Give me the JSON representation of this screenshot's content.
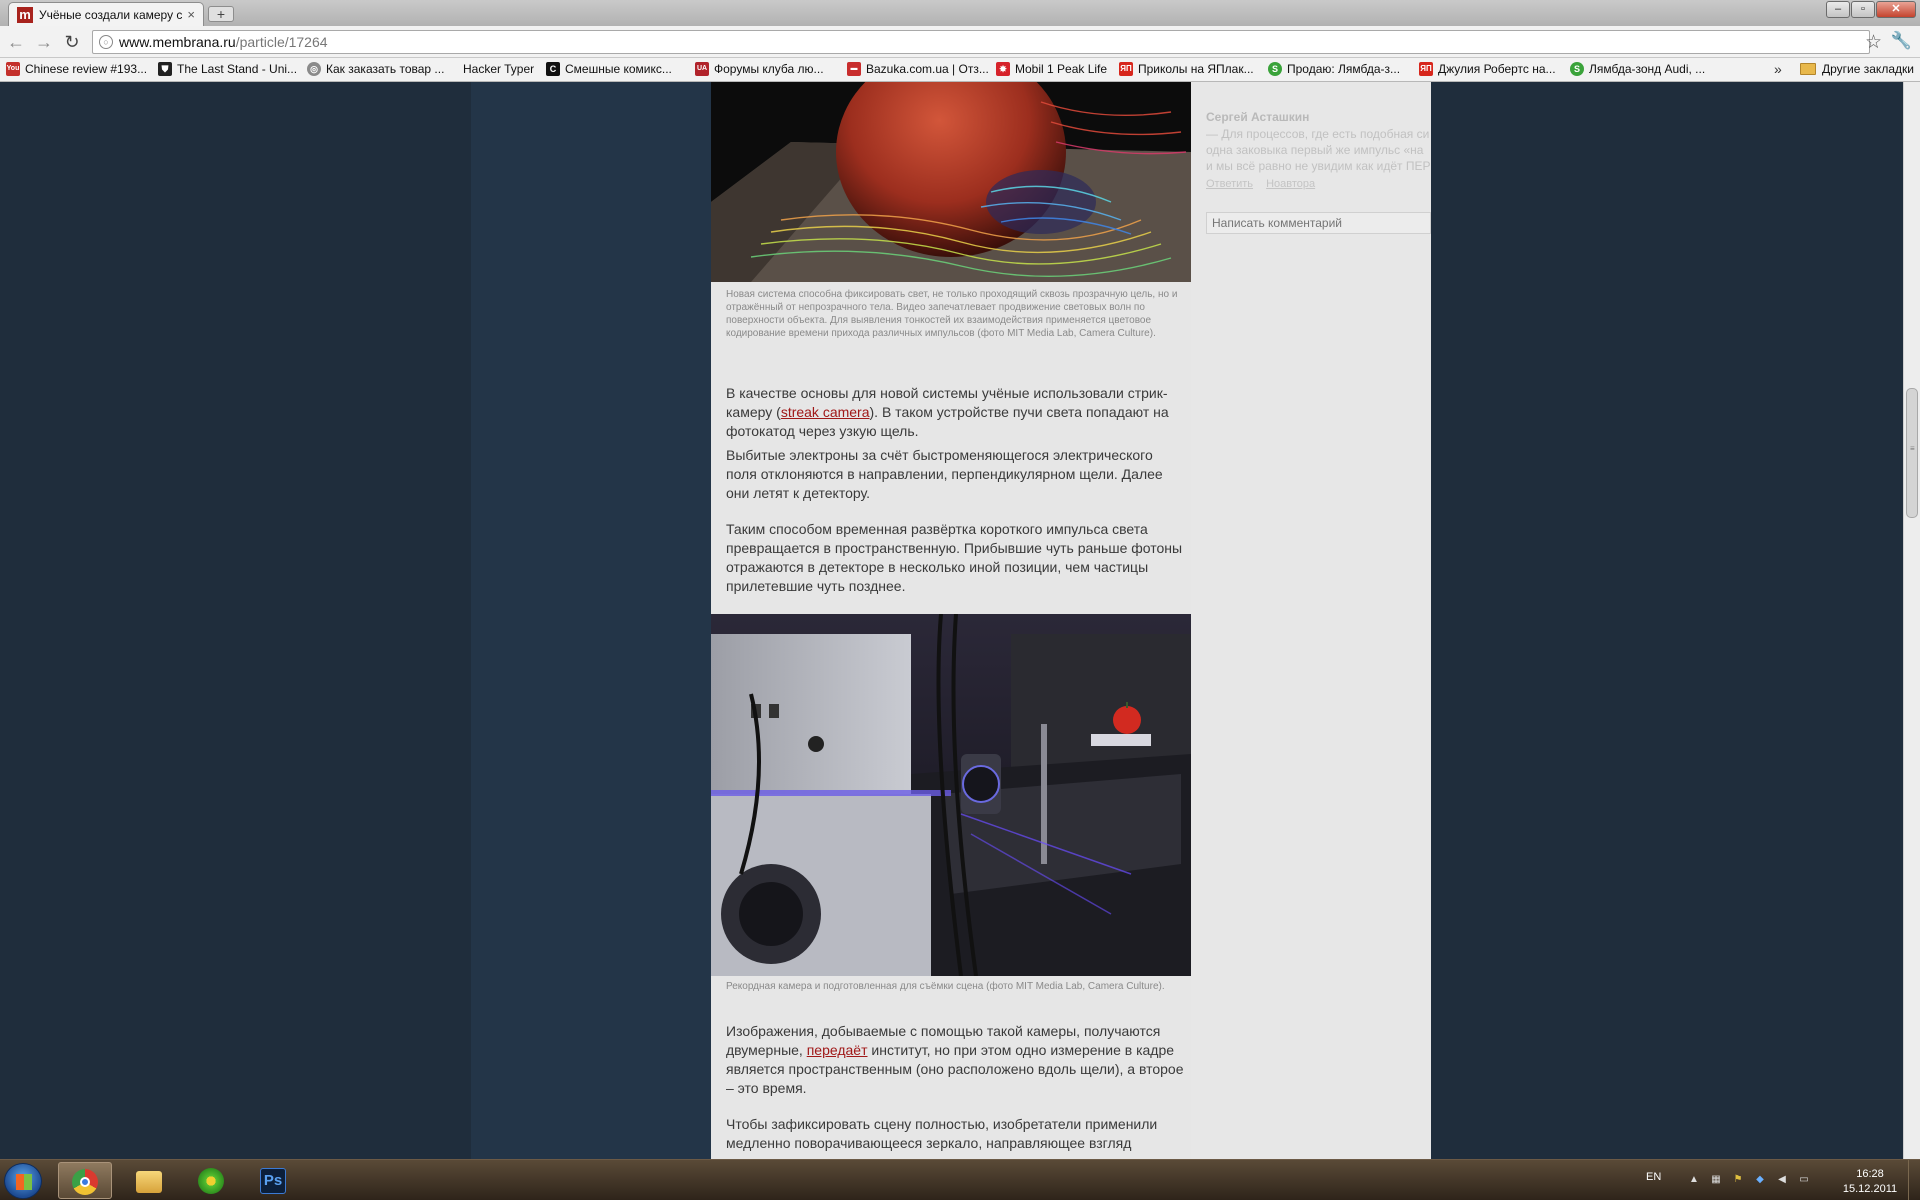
{
  "tab": {
    "title": "Учёные создали камеру с",
    "favicon": "m",
    "close": "×",
    "new_tab": "+"
  },
  "window": {
    "minimize": "–",
    "maximize": "▫",
    "close": "✕"
  },
  "toolbar": {
    "back": "←",
    "forward": "→",
    "reload": "↻",
    "url_host": "www.membrana.ru",
    "url_path": "/particle/17264",
    "star": "☆",
    "wrench": "🔧"
  },
  "bookmarks": {
    "items": [
      {
        "label": "Chinese review #193...",
        "icon": "You",
        "color": "#c4302b"
      },
      {
        "label": "The Last Stand - Uni...",
        "icon": "⛊",
        "color": "#222222"
      },
      {
        "label": "Как заказать товар ...",
        "icon": "◎",
        "color": "#7a7a7a"
      },
      {
        "label": "Hacker Typer",
        "icon": "",
        "color": "transparent"
      },
      {
        "label": "Смешные комикс...",
        "icon": "C",
        "color": "#111111"
      },
      {
        "label": "Форумы клуба лю...",
        "icon": "UA",
        "color": "#b1232b"
      },
      {
        "label": "Bazuka.com.ua | Отз...",
        "icon": "▬",
        "color": "#c82d2d"
      },
      {
        "label": "Mobil 1 Peak Life",
        "icon": "✸",
        "color": "#d6222a"
      },
      {
        "label": "Приколы на ЯПлак...",
        "icon": "ЯП",
        "color": "#d7261c"
      },
      {
        "label": "Продаю: Лямбда-з...",
        "icon": "S",
        "color": "#3aa33a"
      },
      {
        "label": "Джулия Робертс на...",
        "icon": "ЯП",
        "color": "#d7261c"
      },
      {
        "label": "Лямбда-зонд Audi, ...",
        "icon": "S",
        "color": "#3aa33a"
      }
    ],
    "chevron": "»",
    "other": "Другие закладки"
  },
  "sidebar": {
    "comment_author": "Сергей Асташкин",
    "comment_text": "— Для процессов, где есть подобная си\nодна заковыка первый же импульс «на\nи мы всё равно не увидим как идёт ПЕР",
    "reply": "Ответить",
    "link": "Ноавтора",
    "comment_placeholder": "Написать комментарий"
  },
  "article": {
    "caption1": "Новая система способна фиксировать свет, не только проходящий сквозь прозрачную цель, но и отражённый от непрозрачного тела. Видео запечатлевает продвижение световых волн по поверхности объекта. Для выявления тонкостей их взаимодействия применяется цветовое кодирование времени прихода различных импульсов (фото MIT Media Lab, Camera Culture).",
    "p1_before": "В качестве основы для новой системы учёные использовали стрик-камеру (",
    "p1_link": "streak camera",
    "p1_after": "). В таком устройстве пучи света попадают на фотокатод через узкую щель.",
    "p2": "Выбитые электроны за счёт быстроменяющегося электрического поля отклоняются в направлении, перпендикулярном щели. Далее они летят к детектору.",
    "p3": "Таким способом временная развёртка короткого импульса света превращается в пространственную. Прибывшие чуть раньше фотоны отражаются в детекторе в несколько иной позиции, чем частицы прилетевшие чуть позднее.",
    "caption2": "Рекордная камера и подготовленная для съёмки сцена (фото MIT Media Lab, Camera Culture).",
    "p4_before": "Изображения, добываемые с помощью такой камеры, получаются двумерные, ",
    "p4_link": "передаёт",
    "p4_after": " институт, но при этом одно измерение в кадре является пространственным (оно расположено вдоль щели), а второе – это время.",
    "p5": "Чтобы зафиксировать сцену полностью, изобретатели применили медленно поворачивающееся зеркало, направляющее взгляд"
  },
  "taskbar": {
    "lang": "EN",
    "time": "16:28",
    "date": "15.12.2011",
    "apps": [
      {
        "name": "chrome",
        "active": true
      },
      {
        "name": "explorer",
        "active": false
      },
      {
        "name": "icq",
        "active": false
      },
      {
        "name": "photoshop",
        "active": false
      }
    ],
    "ps_label": "Ps"
  },
  "colors": {
    "link": "#a01818",
    "page_bg": "#1f2d3c",
    "article_bg": "#e6e6e6"
  }
}
